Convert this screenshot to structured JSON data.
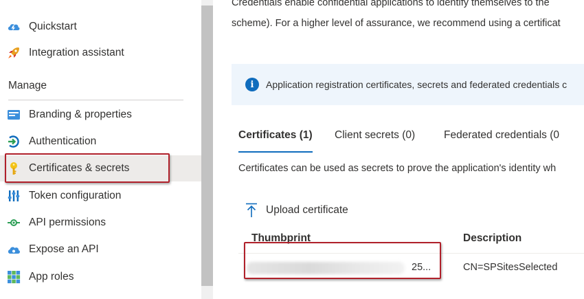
{
  "sidebar": {
    "items_top": [
      {
        "label": "Quickstart",
        "icon": "cloud-lightning-icon"
      },
      {
        "label": "Integration assistant",
        "icon": "rocket-icon"
      }
    ],
    "section_heading": "Manage",
    "items_manage": [
      {
        "label": "Branding & properties",
        "icon": "branding-icon"
      },
      {
        "label": "Authentication",
        "icon": "authentication-icon"
      },
      {
        "label": "Certificates & secrets",
        "icon": "key-icon",
        "selected": true
      },
      {
        "label": "Token configuration",
        "icon": "token-bars-icon"
      },
      {
        "label": "API permissions",
        "icon": "api-permissions-icon"
      },
      {
        "label": "Expose an API",
        "icon": "cloud-api-icon"
      },
      {
        "label": "App roles",
        "icon": "app-roles-grid-icon"
      }
    ]
  },
  "main": {
    "intro_line1": "Credentials enable confidential applications to identify themselves to the",
    "intro_line2": "scheme). For a higher level of assurance, we recommend using a certificat",
    "info_bar_text": "Application registration certificates, secrets and federated credentials c",
    "tabs": [
      {
        "label": "Certificates (1)",
        "active": true
      },
      {
        "label": "Client secrets (0)",
        "active": false
      },
      {
        "label": "Federated credentials (0",
        "active": false
      }
    ],
    "description": "Certificates can be used as secrets to prove the application's identity wh",
    "upload_label": "Upload certificate",
    "table": {
      "columns": [
        "Thumbprint",
        "Description"
      ],
      "rows": [
        {
          "thumbprint_suffix": "25...",
          "description": "CN=SPSitesSelected"
        }
      ]
    }
  },
  "colors": {
    "accent": "#0f6cbd",
    "highlight_border": "#b0202a",
    "selected_bg": "#edebe9",
    "info_bg": "#eef5fc"
  }
}
